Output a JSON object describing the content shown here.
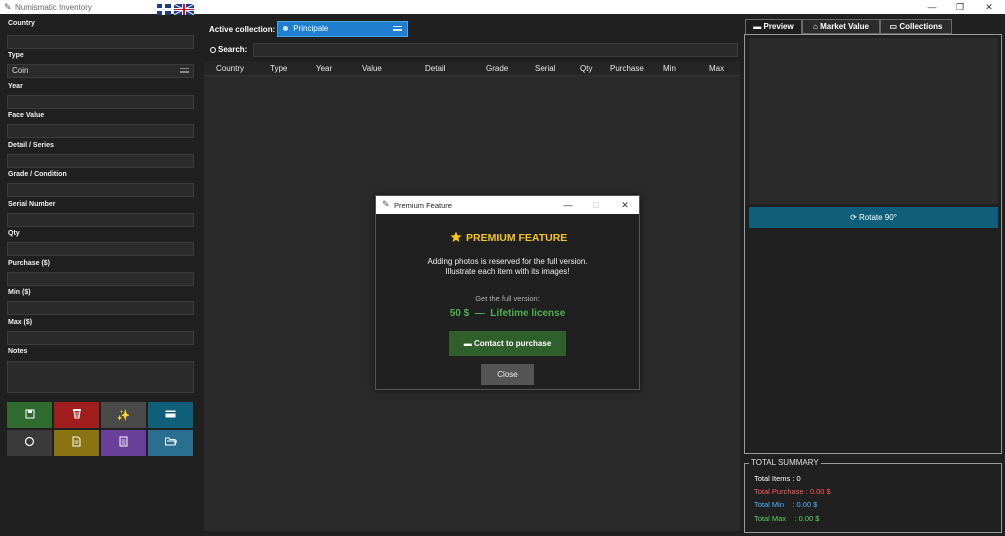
{
  "window": {
    "title": "Numismatic Inventory",
    "minimize": "—",
    "maximize": "❐",
    "close": "✕"
  },
  "form": {
    "fields": [
      {
        "label": "Country",
        "value": ""
      },
      {
        "label": "Type",
        "value": "Coin"
      },
      {
        "label": "Year",
        "value": ""
      },
      {
        "label": "Face Value",
        "value": ""
      },
      {
        "label": "Detail / Series",
        "value": ""
      },
      {
        "label": "Grade / Condition",
        "value": ""
      },
      {
        "label": "Serial Number",
        "value": ""
      },
      {
        "label": "Qty",
        "value": ""
      },
      {
        "label": "Purchase ($)",
        "value": ""
      },
      {
        "label": "Min ($)",
        "value": ""
      },
      {
        "label": "Max ($)",
        "value": ""
      },
      {
        "label": "Notes",
        "value": ""
      }
    ]
  },
  "actions": {
    "colors": {
      "save": "#2f6b2f",
      "delete": "#a01e1e",
      "magic": "#4a4a4a",
      "card": "#0f5f7a",
      "reset": "#3a3a3a",
      "doc": "#8a7412",
      "report": "#6a3f9a",
      "folder": "#2a6f8f"
    }
  },
  "collection": {
    "label": "Active collection:",
    "value": "Principale"
  },
  "search": {
    "label": "Search:",
    "placeholder": ""
  },
  "table": {
    "columns": [
      "Country",
      "Type",
      "Year",
      "Value",
      "Detail",
      "Grade",
      "Serial",
      "Qty",
      "Purchase",
      "Min",
      "Max"
    ]
  },
  "tabs": {
    "preview": "Preview",
    "market": "Market Value",
    "collections": "Collections"
  },
  "preview": {
    "rotate": "Rotate 90°"
  },
  "summary": {
    "title": "TOTAL SUMMARY",
    "items": "Total Items : 0",
    "purchase": "Total Purchase : 0.00 $",
    "min": "Total Min    : 0.00 $",
    "max": "Total Max    : 0.00 $",
    "colors": {
      "items": "#ffffff",
      "purchase": "#ff5a5a",
      "min": "#4fb3ff",
      "max": "#5fd35f"
    }
  },
  "modal": {
    "title": "Premium Feature",
    "heading": "PREMIUM FEATURE",
    "line1": "Adding photos is reserved for the full version.",
    "line2": "Illustrate each item with its images!",
    "get_full": "Get the full version:",
    "price": "50 $  —  Lifetime license",
    "contact": "Contact to purchase",
    "close": "Close"
  }
}
